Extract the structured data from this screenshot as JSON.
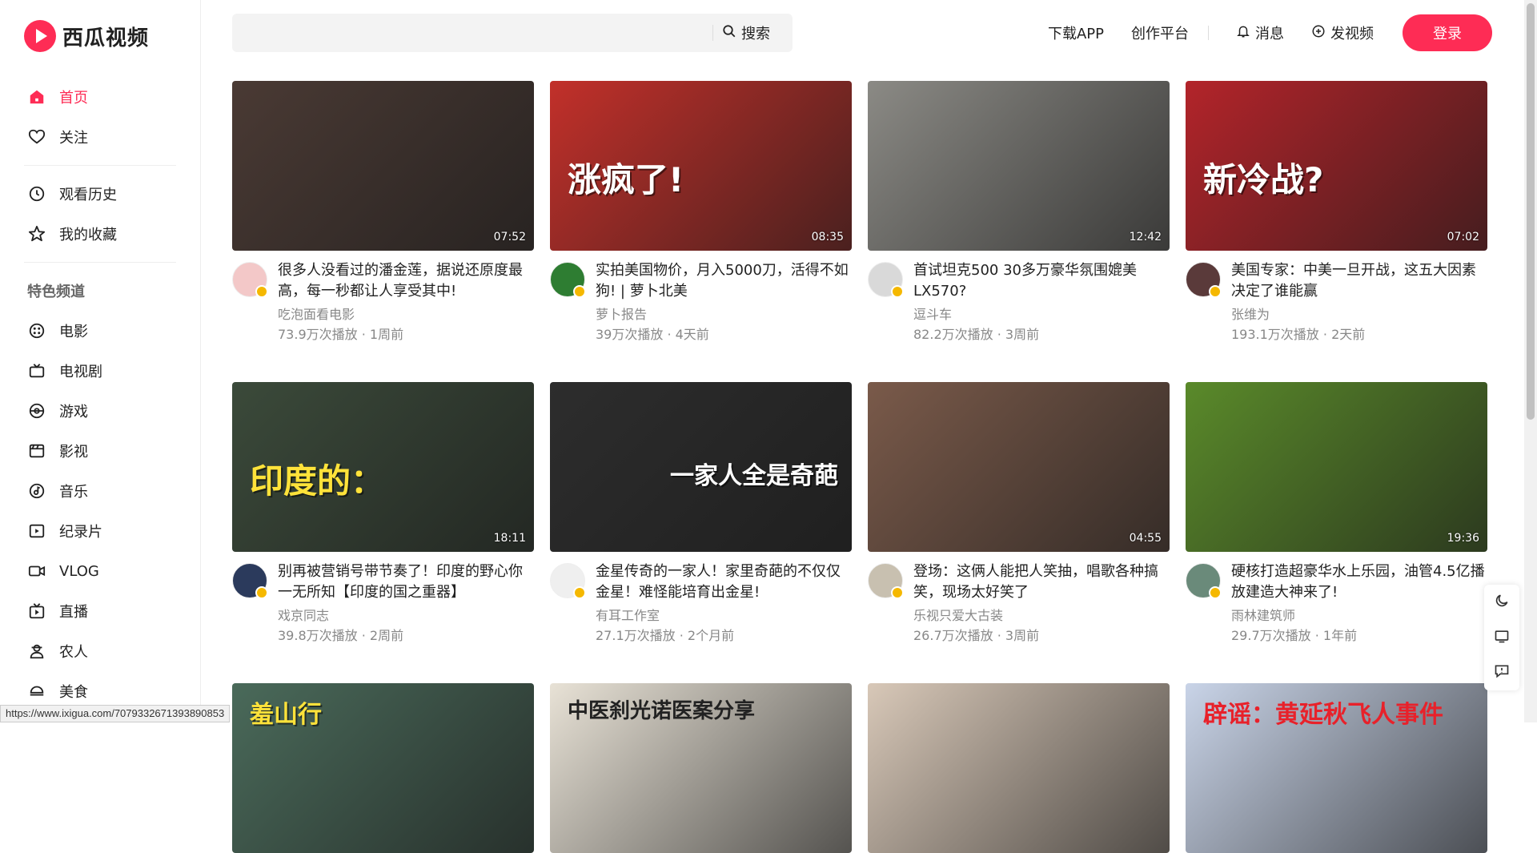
{
  "app": {
    "name": "西瓜视频",
    "brand_color": "#fe2c55"
  },
  "sidebar": {
    "primary": [
      {
        "label": "首页",
        "icon": "home-icon",
        "active": true
      },
      {
        "label": "关注",
        "icon": "heart-icon"
      }
    ],
    "personal": [
      {
        "label": "观看历史",
        "icon": "clock-icon"
      },
      {
        "label": "我的收藏",
        "icon": "star-icon"
      }
    ],
    "channels_heading": "特色频道",
    "channels": [
      {
        "label": "电影",
        "icon": "film-reel-icon"
      },
      {
        "label": "电视剧",
        "icon": "tv-icon"
      },
      {
        "label": "游戏",
        "icon": "game-icon"
      },
      {
        "label": "影视",
        "icon": "clapperboard-icon"
      },
      {
        "label": "音乐",
        "icon": "music-icon"
      },
      {
        "label": "纪录片",
        "icon": "documentary-icon"
      },
      {
        "label": "VLOG",
        "icon": "camera-icon"
      },
      {
        "label": "直播",
        "icon": "live-icon"
      },
      {
        "label": "农人",
        "icon": "farmer-icon"
      },
      {
        "label": "美食",
        "icon": "food-icon"
      }
    ]
  },
  "header": {
    "search_placeholder": "",
    "search_label": "搜索",
    "download": "下载APP",
    "creator": "创作平台",
    "messages": "消息",
    "upload": "发视频",
    "login": "登录"
  },
  "videos": [
    {
      "title": "很多人没看过的潘金莲，据说还原度最高，每一秒都让人享受其中!",
      "author": "吃泡面看电影",
      "stats": "73.9万次播放 · 1周前",
      "duration": "07:52",
      "thumb_color": "#4a3a34",
      "avatar_color": "#f3c8c8",
      "overlay": ""
    },
    {
      "title": "实拍美国物价，月入5000刀，活得不如狗! | 萝卜北美",
      "author": "萝卜报告",
      "stats": "39万次播放 · 4天前",
      "duration": "08:35",
      "thumb_color": "#c2302a",
      "avatar_color": "#2e7d32",
      "overlay": "涨疯了!"
    },
    {
      "title": "首试坦克500 30多万豪华氛围媲美LX570?",
      "author": "逗斗车",
      "stats": "82.2万次播放 · 3周前",
      "duration": "12:42",
      "thumb_color": "#8b8a85",
      "avatar_color": "#d9d9d9",
      "overlay": ""
    },
    {
      "title": "美国专家：中美一旦开战，这五大因素决定了谁能赢",
      "author": "张维为",
      "stats": "193.1万次播放 · 2天前",
      "duration": "07:02",
      "thumb_color": "#b3242a",
      "avatar_color": "#5a3a3a",
      "overlay": "新冷战?"
    },
    {
      "title": "别再被营销号带节奏了！印度的野心你一无所知【印度的国之重器】",
      "author": "戏京同志",
      "stats": "39.8万次播放 · 2周前",
      "duration": "18:11",
      "thumb_color": "#3b4a3a",
      "avatar_color": "#2b3a5c",
      "overlay": "印度的："
    },
    {
      "title": "金星传奇的一家人！家里奇葩的不仅仅金星！难怪能培育出金星!",
      "author": "有耳工作室",
      "stats": "27.1万次播放 · 2个月前",
      "duration": "",
      "thumb_color": "#2d2d2d",
      "avatar_color": "#efefef",
      "overlay": "一家人全是奇葩"
    },
    {
      "title": "登场：这俩人能把人笑抽，唱歌各种搞笑，现场太好笑了",
      "author": "乐视只爱大古装",
      "stats": "26.7万次播放 · 3周前",
      "duration": "04:55",
      "thumb_color": "#7a5a4a",
      "avatar_color": "#c8c0b0",
      "overlay": ""
    },
    {
      "title": "硬核打造超豪华水上乐园，油管4.5亿播放建造大神来了!",
      "author": "雨林建筑师",
      "stats": "29.7万次播放 · 1年前",
      "duration": "19:36",
      "thumb_color": "#5a8a2a",
      "avatar_color": "#6a8a7a",
      "overlay": ""
    },
    {
      "title": "",
      "author": "",
      "stats": "",
      "duration": "",
      "thumb_color": "#4a6a5a",
      "avatar_color": "#eee",
      "overlay": "羞山行"
    },
    {
      "title": "",
      "author": "",
      "stats": "",
      "duration": "",
      "thumb_color": "#e8e2d6",
      "avatar_color": "#eee",
      "overlay": "中医刹光诺医案分享"
    },
    {
      "title": "",
      "author": "",
      "stats": "",
      "duration": "",
      "thumb_color": "#d8c8b8",
      "avatar_color": "#eee",
      "overlay": ""
    },
    {
      "title": "",
      "author": "",
      "stats": "",
      "duration": "",
      "thumb_color": "#c9d4e8",
      "avatar_color": "#eee",
      "overlay": "辟谣：黄延秋飞人事件"
    }
  ],
  "status_url": "https://www.ixigua.com/7079332671393890853"
}
